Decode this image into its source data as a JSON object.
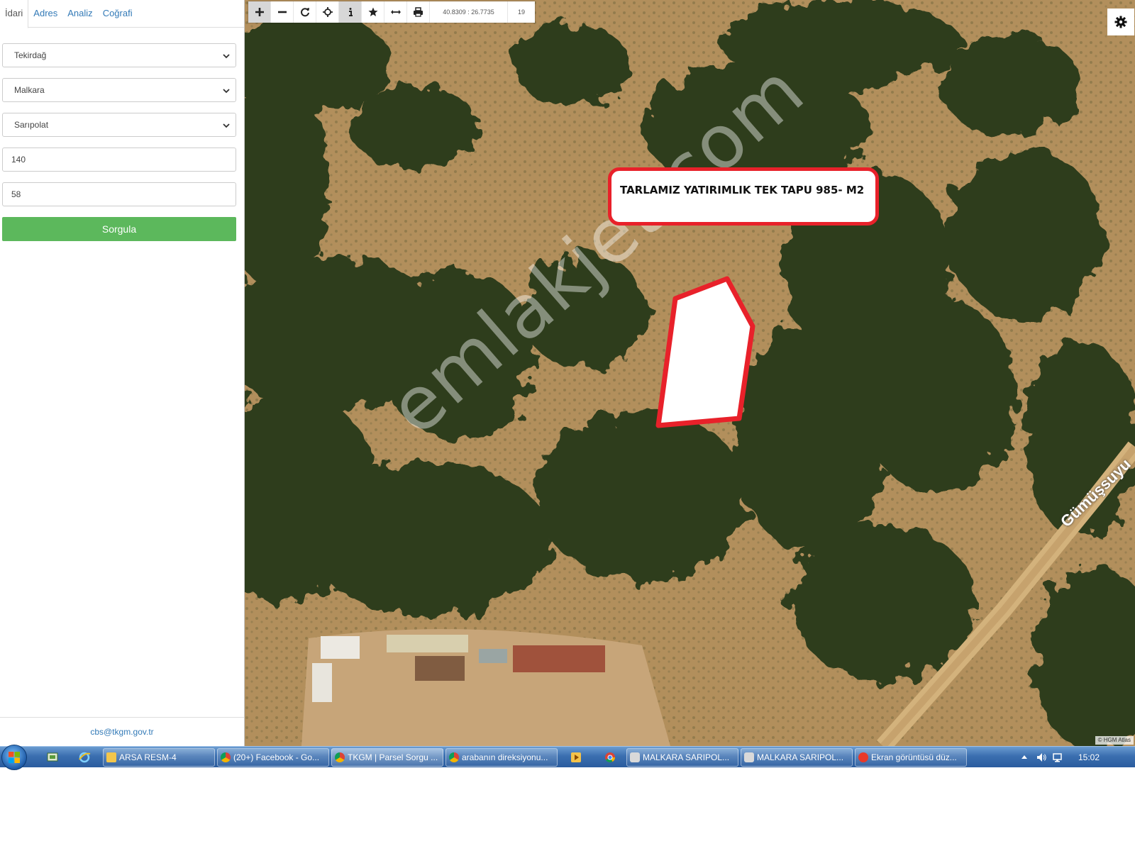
{
  "sidebar": {
    "tabs": [
      "İdari",
      "Adres",
      "Analiz",
      "Coğrafi"
    ],
    "province": "Tekirdağ",
    "district": "Malkara",
    "neighborhood": "Sarıpolat",
    "block": "140",
    "parcel": "58",
    "query_label": "Sorgula",
    "contact_email": "cbs@tkgm.gov.tr"
  },
  "map": {
    "coordinates": "40.8309 : 26.7735",
    "zoom_level": "19",
    "callout_text": "TARLAMIZ YATIRIMLIK TEK TAPU 985- M2",
    "watermark": "emlakjet.com",
    "road_label": "Gümüşsuyu",
    "attribution": "© HGM Atlas",
    "parcel_fill": "#ffffff",
    "parcel_outline": "#e8212a",
    "toolbar_icons": [
      "plus-icon",
      "minus-icon",
      "refresh-icon",
      "locate-icon",
      "info-icon",
      "star-icon",
      "measure-icon",
      "print-icon"
    ]
  },
  "taskbar": {
    "tasks": [
      "ARSA RESM-4",
      "(20+) Facebook - Go...",
      "TKGM | Parsel Sorgu ...",
      "arabanın direksiyonu...",
      "MALKARA SARIPOL...",
      "MALKARA SARIPOL...",
      "Ekran görüntüsü düz..."
    ],
    "clock": "15:02"
  },
  "colors": {
    "link": "#337ab7",
    "button_green": "#5cb85c",
    "callout_border": "#e8212a",
    "taskbar_blue": "#3b6fb0"
  }
}
